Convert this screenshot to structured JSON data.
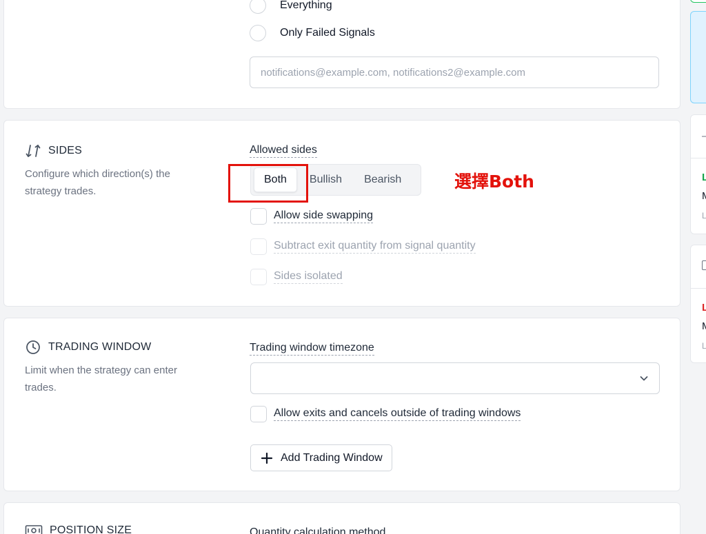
{
  "notifications": {
    "options": [
      {
        "label": "Everything"
      },
      {
        "label": "Only Failed Signals"
      }
    ],
    "email_placeholder": "notifications@example.com, notifications2@example.com"
  },
  "sides": {
    "title": "SIDES",
    "description": "Configure which direction(s) the strategy trades.",
    "allowed_label": "Allowed sides",
    "options": [
      "Both",
      "Bullish",
      "Bearish"
    ],
    "selected": "Both",
    "annotation": "選擇Both",
    "checkboxes": [
      {
        "label": "Allow side swapping",
        "enabled": true
      },
      {
        "label": "Subtract exit quantity from signal quantity",
        "enabled": false
      },
      {
        "label": "Sides isolated",
        "enabled": false
      }
    ]
  },
  "trading_window": {
    "title": "TRADING WINDOW",
    "description": "Limit when the strategy can enter trades.",
    "timezone_label": "Trading window timezone",
    "timezone_value": "",
    "exit_checkbox_label": "Allow exits and cancels outside of trading windows",
    "add_button_label": "Add Trading Window"
  },
  "position_size": {
    "title": "POSITION SIZE",
    "method_label": "Quantity calculation method"
  },
  "right_panel": {
    "glyphs": [
      "—",
      "L",
      "M",
      "L",
      "L",
      "M",
      "L"
    ],
    "colors": {
      "green": "#16a34a",
      "red": "#dc2626",
      "blue_tint": "#e0f2fe",
      "accent": "#22c55e"
    }
  }
}
